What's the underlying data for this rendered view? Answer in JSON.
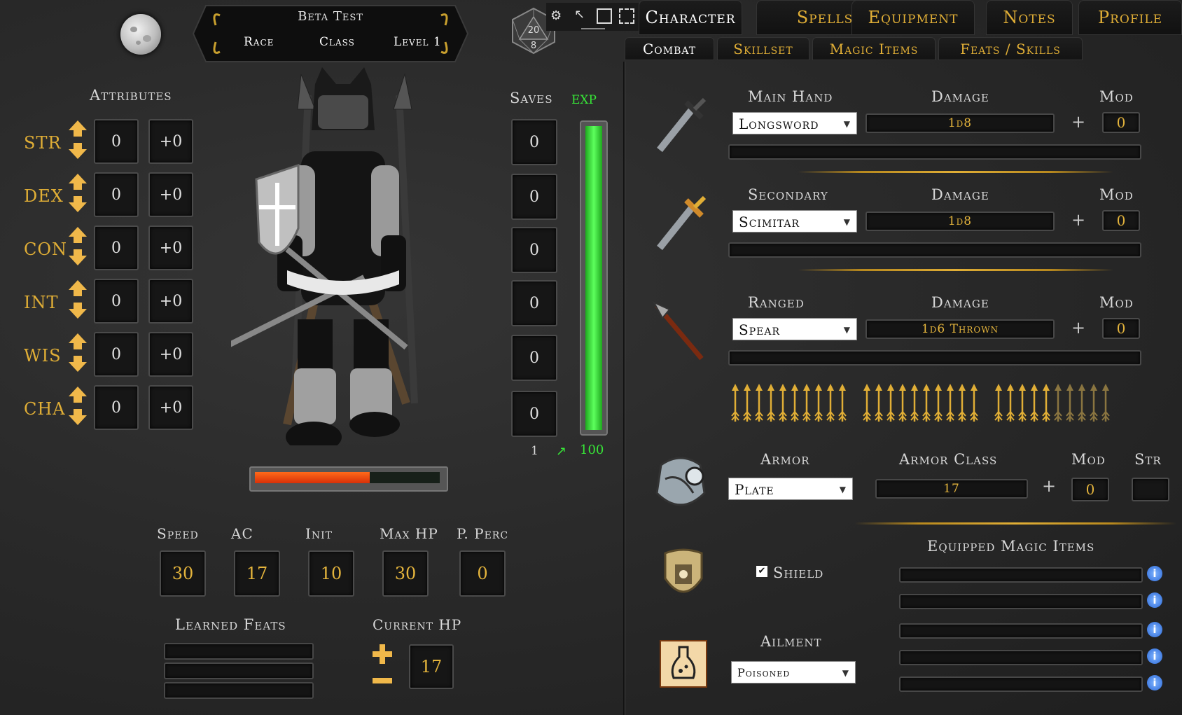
{
  "header": {
    "character_name": "Beta Test",
    "race_label": "Race",
    "class_label": "Class",
    "level_label": "Level 1",
    "d20_values": [
      "20",
      "8"
    ]
  },
  "toolbar": {
    "icons": [
      "settings-icon",
      "pointer-icon",
      "frame-icon",
      "select-region-icon"
    ]
  },
  "tabs": [
    "Character",
    "Spells",
    "Equipment",
    "Notes",
    "Profile"
  ],
  "subtabs": [
    "Combat",
    "Skillset",
    "Magic Items",
    "Feats / Skills"
  ],
  "attributes": {
    "title": "Attributes",
    "items": [
      {
        "name": "STR",
        "value": "0",
        "mod": "+0"
      },
      {
        "name": "DEX",
        "value": "0",
        "mod": "+0"
      },
      {
        "name": "CON",
        "value": "0",
        "mod": "+0"
      },
      {
        "name": "INT",
        "value": "0",
        "mod": "+0"
      },
      {
        "name": "WIS",
        "value": "0",
        "mod": "+0"
      },
      {
        "name": "CHA",
        "value": "0",
        "mod": "+0"
      }
    ]
  },
  "saves": {
    "title": "Saves",
    "values": [
      "0",
      "0",
      "0",
      "0",
      "0",
      "0"
    ]
  },
  "exp": {
    "title": "exp",
    "level": "1",
    "max": "100",
    "fill_fraction": 1.0
  },
  "hp_bar": {
    "fill_fraction": 0.62
  },
  "stats": [
    {
      "label": "Speed",
      "value": "30"
    },
    {
      "label": "AC",
      "value": "17"
    },
    {
      "label": "Init",
      "value": "10"
    },
    {
      "label": "Max HP",
      "value": "30"
    },
    {
      "label": "P. Perc",
      "value": "0"
    }
  ],
  "learned_feats": {
    "label": "Learned Feats"
  },
  "current_hp": {
    "label": "Current HP",
    "value": "17"
  },
  "weapons": [
    {
      "slot": "Main Hand",
      "weapon": "Longsword",
      "damage_label": "Damage",
      "damage": "1d8",
      "mod_label": "Mod",
      "mod": "0",
      "plus": "+"
    },
    {
      "slot": "Secondary",
      "weapon": "Scimitar",
      "damage_label": "Damage",
      "damage": "1d8",
      "mod_label": "Mod",
      "mod": "0",
      "plus": "+"
    },
    {
      "slot": "Ranged",
      "weapon": "Spear",
      "damage_label": "Damage",
      "damage": "1d6 Thrown",
      "mod_label": "Mod",
      "mod": "0",
      "plus": "+"
    }
  ],
  "ammo": {
    "total": 30,
    "available": 25
  },
  "armor": {
    "label": "Armor",
    "value": "Plate",
    "ac_label": "Armor Class",
    "ac": "17",
    "mod_label": "Mod",
    "mod": "0",
    "str_label": "Str",
    "str": "",
    "plus": "+"
  },
  "shield": {
    "label": "Shield",
    "checked": "✔"
  },
  "magic_items": {
    "label": "Equipped Magic Items",
    "info_glyph": "i"
  },
  "ailment": {
    "label": "Ailment",
    "value": "Poisoned"
  }
}
